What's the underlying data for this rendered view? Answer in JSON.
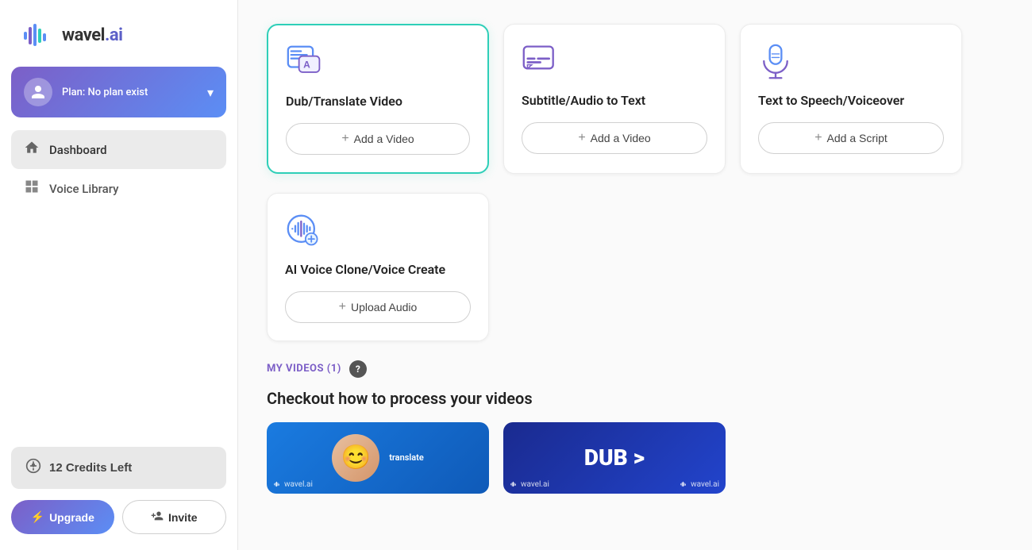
{
  "brand": {
    "name": "wavel.ai",
    "name_prefix": "wavel",
    "name_suffix": ".ai"
  },
  "sidebar": {
    "profile": {
      "plan": "Plan: No plan exist",
      "chevron": "▾"
    },
    "nav_items": [
      {
        "id": "dashboard",
        "label": "Dashboard",
        "icon": "home",
        "active": true
      },
      {
        "id": "voice-library",
        "label": "Voice Library",
        "icon": "grid",
        "active": false
      }
    ],
    "credits": {
      "label": "12 Credits Left",
      "icon": "💲"
    },
    "buttons": {
      "upgrade": "Upgrade",
      "invite": "Invite"
    }
  },
  "main": {
    "feature_cards": [
      {
        "id": "dub-translate",
        "title": "Dub/Translate Video",
        "action_label": "+ Add a Video",
        "highlighted": true,
        "icon": "translate"
      },
      {
        "id": "subtitle-audio",
        "title": "Subtitle/Audio to Text",
        "action_label": "+ Add a Video",
        "highlighted": false,
        "icon": "subtitle"
      },
      {
        "id": "text-to-speech",
        "title": "Text to Speech/Voiceover",
        "action_label": "+ Add a Script",
        "highlighted": false,
        "icon": "mic"
      },
      {
        "id": "ai-voice-clone",
        "title": "AI Voice Clone/Voice Create",
        "action_label": "+ Upload Audio",
        "highlighted": false,
        "icon": "voice-clone"
      }
    ],
    "my_videos_section": {
      "title": "MY VIDEOS (1)",
      "help_icon": "?",
      "checkout_title": "Checkout how to process your videos"
    }
  }
}
